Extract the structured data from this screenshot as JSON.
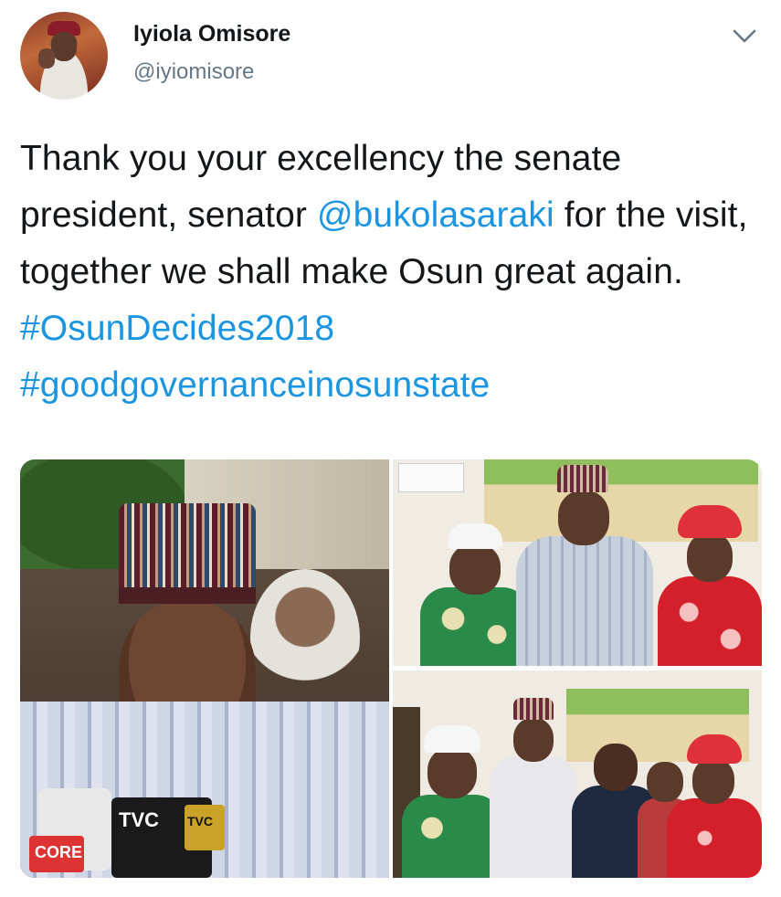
{
  "user": {
    "display_name": "Iyiola Omisore",
    "handle": "@iyiomisore",
    "avatar_icon": "profile-photo"
  },
  "menu_icon": "chevron-down-icon",
  "tweet": {
    "text_1": "Thank you your excellency the senate president, senator ",
    "mention": "@bukolasaraki",
    "text_2": " for the visit, together we shall make Osun great again. ",
    "hashtag_1": "#OsunDecides2018",
    "hashtag_2": "#goodgovernanceinosunstate"
  },
  "colors": {
    "link": "#1b95e0",
    "text": "#14171a",
    "secondary": "#657786"
  },
  "media": {
    "photos": [
      {
        "name": "press-interview-photo",
        "mic_labels": [
          "TVC",
          "TVC",
          "CORE"
        ]
      },
      {
        "name": "group-photo-three"
      },
      {
        "name": "group-photo-five"
      }
    ]
  }
}
